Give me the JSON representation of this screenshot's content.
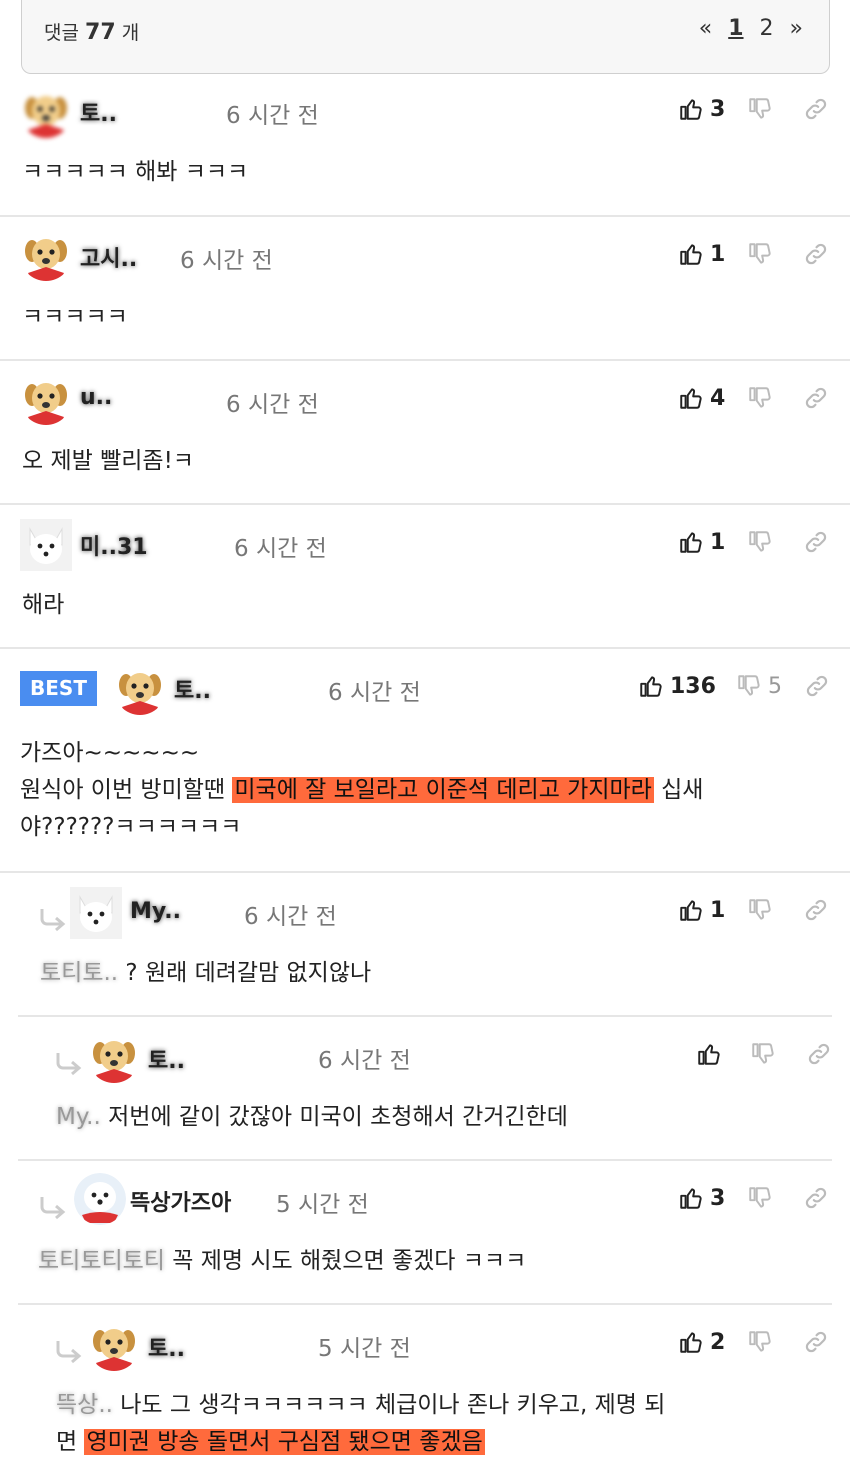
{
  "header": {
    "count_label": "댓글",
    "count_value": "77",
    "count_unit": "개",
    "pager": {
      "prev": "«",
      "pages": [
        "1",
        "2"
      ],
      "current": "1",
      "next": "»"
    }
  },
  "comments": [
    {
      "nick": "토..",
      "time": "6 시간 전",
      "likes": "3",
      "text": "ㅋㅋㅋㅋㅋ 해봐 ㅋㅋㅋ",
      "avatar": "dog-blurred-avatar"
    },
    {
      "nick": "고시..",
      "time": "6 시간 전",
      "likes": "1",
      "text": "ㅋㅋㅋㅋㅋ",
      "avatar": "dog-avatar"
    },
    {
      "nick": "u..",
      "time": "6 시간 전",
      "likes": "4",
      "text": "오 제발 빨리좀!ㅋ",
      "avatar": "dog-avatar"
    },
    {
      "nick": "미..31",
      "time": "6 시간 전",
      "likes": "1",
      "text": "해라",
      "avatar": "white-fox-avatar"
    },
    {
      "badge": "BEST",
      "nick": "토..",
      "time": "6 시간 전",
      "likes": "136",
      "dislikes": "5",
      "text_1": "가즈아~~~~~~",
      "text_2_pre": "원식아 이번 방미할땐 ",
      "text_2_hl": "미국에 잘 보일라고 이준석 데리고 가지마라",
      "text_2_post": " 십새",
      "text_3": "야??????ㅋㅋㅋㅋㅋㅋ",
      "avatar": "dog-avatar"
    },
    {
      "nick": "My..",
      "time": "6 시간 전",
      "likes": "1",
      "mention": "토티토..",
      "text": " ? 원래 데려갈맘 없지않나",
      "avatar": "white-fox-avatar"
    },
    {
      "nick": "토..",
      "time": "6 시간 전",
      "likes": "",
      "mention": "My..",
      "text": " 저번에 같이 갔잖아 미국이 초청해서 간거긴한데",
      "avatar": "dog-avatar"
    },
    {
      "nick": "뜩상가즈아",
      "time": "5 시간 전",
      "likes": "3",
      "mention": "토티토티토티",
      "text": " 꼭 제명 시도 해줬으면 좋겠다 ㅋㅋㅋ",
      "avatar": "white-dog-avatar"
    },
    {
      "nick": "토..",
      "time": "5 시간 전",
      "likes": "2",
      "mention": "뜩상..",
      "text_1": " 나도 그 생각ㅋㅋㅋㅋㅋㅋ 체급이나 존나 키우고, 제명 되",
      "text_2_pre": "면 ",
      "text_2_hl": "영미권 방송 돌면서 구심점 됐으면 좋겠음",
      "avatar": "dog-avatar"
    }
  ],
  "colors": {
    "highlight": "#ff6a3c",
    "best_badge": "#4a8df0",
    "divider": "#e6e6e6"
  }
}
